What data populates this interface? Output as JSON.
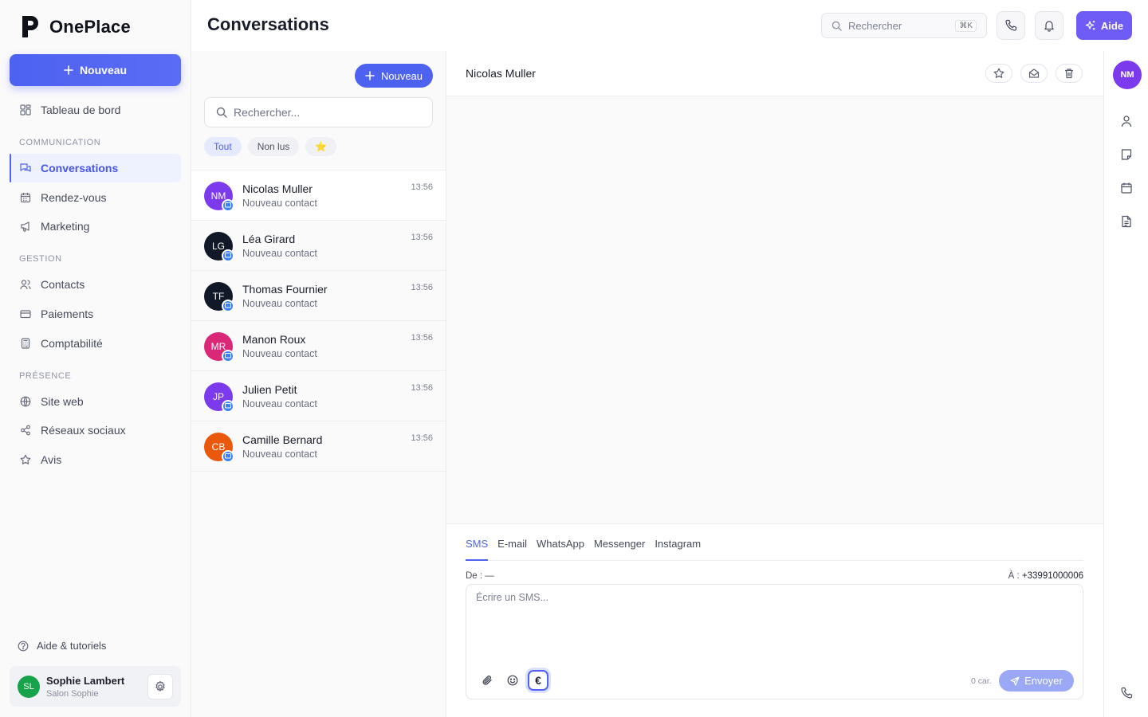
{
  "app": {
    "name": "OnePlace",
    "new_label": "Nouveau"
  },
  "sidebar": {
    "dashboard": "Tableau de bord",
    "sections": [
      {
        "title": "COMMUNICATION",
        "items": [
          {
            "label": "Conversations",
            "icon": "chat-icon",
            "active": true
          },
          {
            "label": "Rendez-vous",
            "icon": "calendar-icon"
          },
          {
            "label": "Marketing",
            "icon": "megaphone-icon"
          }
        ]
      },
      {
        "title": "GESTION",
        "items": [
          {
            "label": "Contacts",
            "icon": "users-icon"
          },
          {
            "label": "Paiements",
            "icon": "credit-card-icon"
          },
          {
            "label": "Comptabilité",
            "icon": "calculator-icon"
          }
        ]
      },
      {
        "title": "PRÉSENCE",
        "items": [
          {
            "label": "Site web",
            "icon": "globe-icon"
          },
          {
            "label": "Réseaux sociaux",
            "icon": "share-icon"
          },
          {
            "label": "Avis",
            "icon": "star-icon"
          }
        ]
      }
    ],
    "help_label": "Aide & tutoriels",
    "user": {
      "initials": "SL",
      "name": "Sophie Lambert",
      "business": "Salon Sophie",
      "avatar_color": "#16a34a"
    }
  },
  "header": {
    "title": "Conversations",
    "search_placeholder": "Rechercher",
    "search_shortcut": "⌘K",
    "help_button": "Aide"
  },
  "conversations": {
    "new_label": "Nouveau",
    "search_placeholder": "Rechercher...",
    "filters": [
      "Tout",
      "Non lus",
      "⭐"
    ],
    "items": [
      {
        "initials": "NM",
        "name": "Nicolas Muller",
        "subtitle": "Nouveau contact",
        "time": "13:56",
        "color": "#7c3aed"
      },
      {
        "initials": "LG",
        "name": "Léa Girard",
        "subtitle": "Nouveau contact",
        "time": "13:56",
        "color": "#111827"
      },
      {
        "initials": "TF",
        "name": "Thomas Fournier",
        "subtitle": "Nouveau contact",
        "time": "13:56",
        "color": "#111827"
      },
      {
        "initials": "MR",
        "name": "Manon Roux",
        "subtitle": "Nouveau contact",
        "time": "13:56",
        "color": "#db2777"
      },
      {
        "initials": "JP",
        "name": "Julien Petit",
        "subtitle": "Nouveau contact",
        "time": "13:56",
        "color": "#7c3aed"
      },
      {
        "initials": "CB",
        "name": "Camille Bernard",
        "subtitle": "Nouveau contact",
        "time": "13:56",
        "color": "#ea580c"
      }
    ]
  },
  "chat": {
    "contact_name": "Nicolas Muller",
    "channels": [
      "SMS",
      "E-mail",
      "WhatsApp",
      "Messenger",
      "Instagram"
    ],
    "from_label": "De :",
    "from_value": "—",
    "to_label": "À :",
    "to_value": "+33991000006",
    "placeholder": "Écrire un SMS...",
    "char_count": "0 car.",
    "send_label": "Envoyer",
    "euro_symbol": "€"
  },
  "rail": {
    "initials": "NM"
  }
}
